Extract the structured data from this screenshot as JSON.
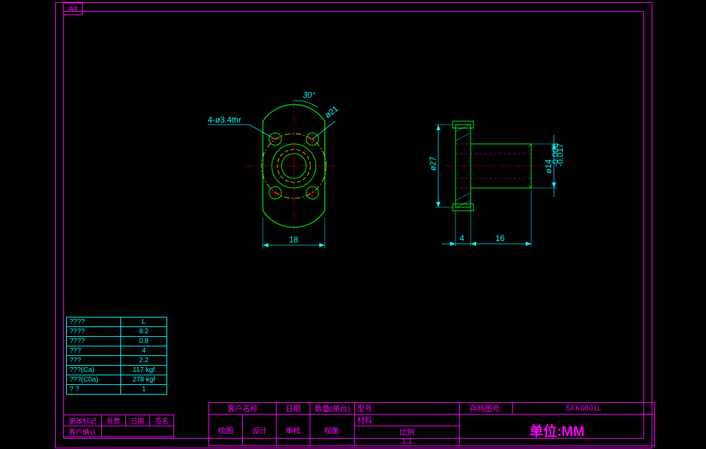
{
  "sheet": {
    "size": "A4"
  },
  "dimensions": {
    "hole_callout": "4-ø3.4thr",
    "angle": "30°",
    "bolt_circle": "ø21",
    "width": "18",
    "outer_dia": "ø27",
    "shaft_dia": "ø14",
    "shaft_tol_upper": "-0.006",
    "shaft_tol_lower": "-0.017",
    "flange_thk": "4",
    "shaft_len": "16"
  },
  "params": {
    "rows": [
      {
        "label": "????",
        "value": "L"
      },
      {
        "label": "????",
        "value": "8.2"
      },
      {
        "label": "????",
        "value": "0.8"
      },
      {
        "label": "???",
        "value": "4"
      },
      {
        "label": "???",
        "value": "2.2"
      },
      {
        "label": "???(Ca)",
        "value": "117 kgf"
      },
      {
        "label": "???(C0a)",
        "value": "278 kgf"
      },
      {
        "label": "? ?",
        "value": "1"
      }
    ]
  },
  "revision": {
    "headers": [
      "更改标记",
      "处数",
      "日期",
      "签名"
    ],
    "row2": "客户确认"
  },
  "title_block": {
    "row1": {
      "customer_label": "客户名称",
      "date_label": "日期",
      "qty_label": "数量(单台)",
      "model_label": "型号:",
      "archive_label": "存档图号:",
      "archive_value": "SFK0801L"
    },
    "row2": {
      "material_label": "材料:"
    },
    "row3": {
      "draw": "绘图",
      "design": "设计",
      "check": "审核",
      "view": "视角:",
      "scale": "比例",
      "scale_val": "1:1",
      "unit": "单位:MM"
    }
  }
}
